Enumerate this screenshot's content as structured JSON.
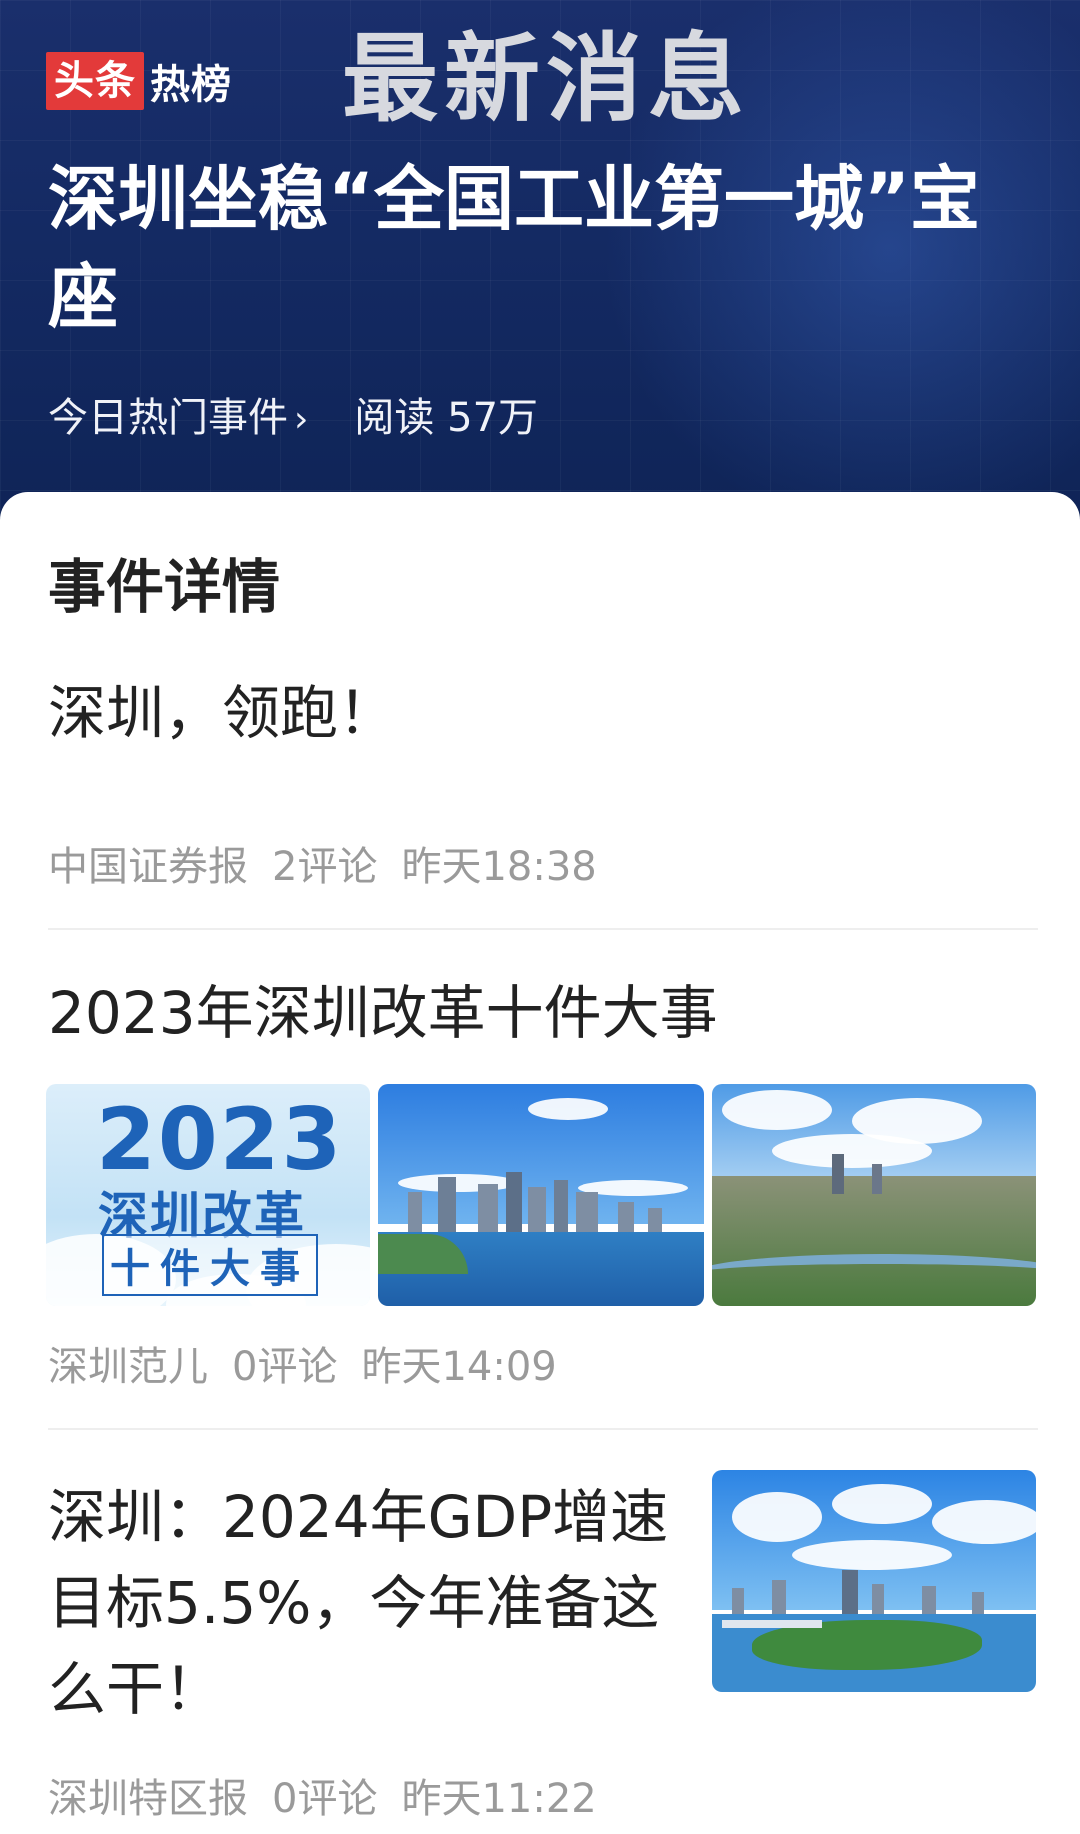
{
  "header": {
    "brand_left": "头条",
    "brand_right": "热榜",
    "banner": "最新消息",
    "headline": "深圳坐稳“全国工业第一城”宝座",
    "hot_link": "今日热门事件",
    "chevron": "›",
    "reads": "阅读 57万"
  },
  "section_title": "事件详情",
  "articles": [
    {
      "title": "深圳，领跑！",
      "source": "中国证券报",
      "comments": "2评论",
      "time": "昨天18:38"
    },
    {
      "title": "2023年深圳改革十件大事",
      "source": "深圳范儿",
      "comments": "0评论",
      "time": "昨天14:09",
      "thumb1": {
        "year": "2023",
        "line2": "深圳改革",
        "line3": "十件大事"
      }
    },
    {
      "title": "深圳：2024年GDP增速目标5.5%，今年准备这么干！",
      "source": "深圳特区报",
      "comments": "0评论",
      "time": "昨天11:22"
    }
  ]
}
